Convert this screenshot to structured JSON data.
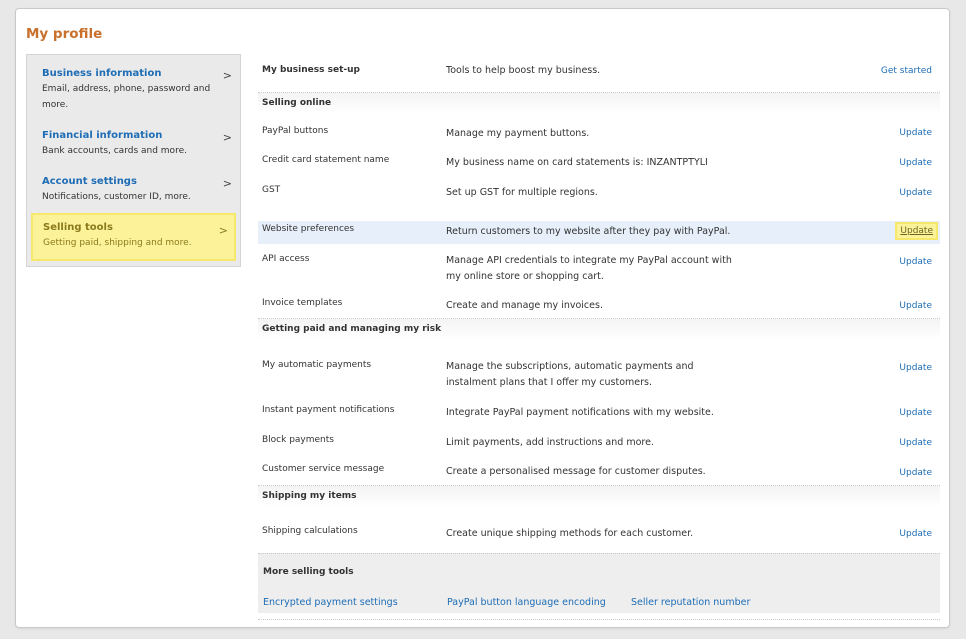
{
  "page": {
    "title": "My profile"
  },
  "sidebar": {
    "items": [
      {
        "title": "Business information",
        "desc": "Email, address, phone, password and more."
      },
      {
        "title": "Financial information",
        "desc": "Bank accounts, cards and more."
      },
      {
        "title": "Account settings",
        "desc": "Notifications, customer ID, more."
      },
      {
        "title": "Selling tools",
        "desc": "Getting paid, shipping and more.",
        "selected": true
      }
    ],
    "chevron": ">"
  },
  "business_setup": {
    "name": "My business set-up",
    "desc": "Tools to help boost my business.",
    "action": "Get started"
  },
  "sections": [
    {
      "heading": "Selling online",
      "rows": [
        {
          "name": "PayPal buttons",
          "desc": "Manage my payment buttons.",
          "action": "Update"
        },
        {
          "name": "Credit card statement name",
          "desc": "My business name on card statements is: INZANTPTYLI",
          "action": "Update"
        },
        {
          "name": "GST",
          "desc": "Set up GST for multiple regions.",
          "action": "Update"
        },
        {
          "name": "Website preferences",
          "desc": "Return customers to my website after they pay with PayPal.",
          "action": "Update",
          "highlighted": true
        },
        {
          "name": "API access",
          "desc": "Manage API credentials to integrate my PayPal account with my online store or shopping cart.",
          "action": "Update"
        },
        {
          "name": "Invoice templates",
          "desc": "Create and manage my invoices.",
          "action": "Update"
        }
      ]
    },
    {
      "heading": "Getting paid and managing my risk",
      "rows": [
        {
          "name": "My automatic payments",
          "desc": "Manage the subscriptions, automatic payments and instalment plans that I offer my customers.",
          "action": "Update"
        },
        {
          "name": "Instant payment notifications",
          "desc": "Integrate PayPal payment notifications with my website.",
          "action": "Update"
        },
        {
          "name": "Block payments",
          "desc": "Limit payments, add instructions and more.",
          "action": "Update"
        },
        {
          "name": "Customer service message",
          "desc": "Create a personalised message for customer disputes.",
          "action": "Update"
        }
      ]
    },
    {
      "heading": "Shipping my items",
      "rows": [
        {
          "name": "Shipping calculations",
          "desc": "Create unique shipping methods for each customer.",
          "action": "Update"
        }
      ]
    }
  ],
  "more_tools": {
    "heading": "More selling tools",
    "links": [
      "Encrypted payment settings",
      "PayPal button language encoding",
      "Seller reputation number"
    ]
  },
  "colors": {
    "accent_title": "#c8702c",
    "link": "#1e6db5",
    "highlight": "#fbf29a",
    "row_highlight": "#e7f0fa"
  }
}
